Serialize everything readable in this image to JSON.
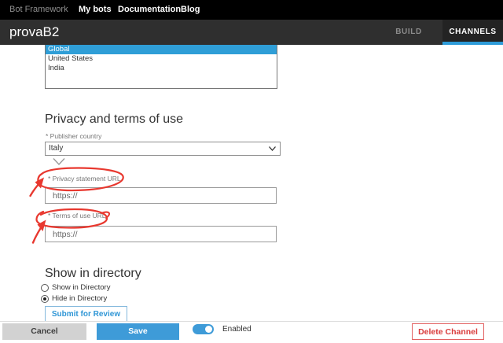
{
  "topnav": {
    "brand": "Bot Framework",
    "items": [
      {
        "label": "My bots"
      },
      {
        "label": "Documentation"
      },
      {
        "label": "Blog"
      }
    ]
  },
  "header": {
    "bot_name": "provaB2",
    "tabs": [
      {
        "label": "BUILD",
        "active": false
      },
      {
        "label": "CHANNELS",
        "active": true
      }
    ]
  },
  "country_list": {
    "items": [
      {
        "label": "Global",
        "selected": true
      },
      {
        "label": "United States",
        "selected": false
      },
      {
        "label": "India",
        "selected": false
      }
    ]
  },
  "privacy": {
    "heading": "Privacy and terms of use",
    "publisher_country": {
      "label": "* Publisher country",
      "value": "Italy"
    },
    "privacy_url": {
      "label": "* Privacy statement URL",
      "placeholder": "https://"
    },
    "terms_url": {
      "label": "* Terms of use URL",
      "placeholder": "https://"
    }
  },
  "directory": {
    "heading": "Show in directory",
    "options": [
      {
        "label": "Show in Directory",
        "selected": false
      },
      {
        "label": "Hide in Directory",
        "selected": true
      }
    ],
    "submit_label": "Submit for Review"
  },
  "footer": {
    "cancel_label": "Cancel",
    "save_label": "Save",
    "toggle_label": "Enabled",
    "toggle_state": "on",
    "delete_label": "Delete Channel"
  },
  "colors": {
    "accent_blue": "#3e9bd8",
    "selection_blue": "#2f9ed7",
    "tab_underline_blue": "#2d9bd8",
    "delete_red": "#d93b3b",
    "annotation_red": "#e8382f"
  }
}
